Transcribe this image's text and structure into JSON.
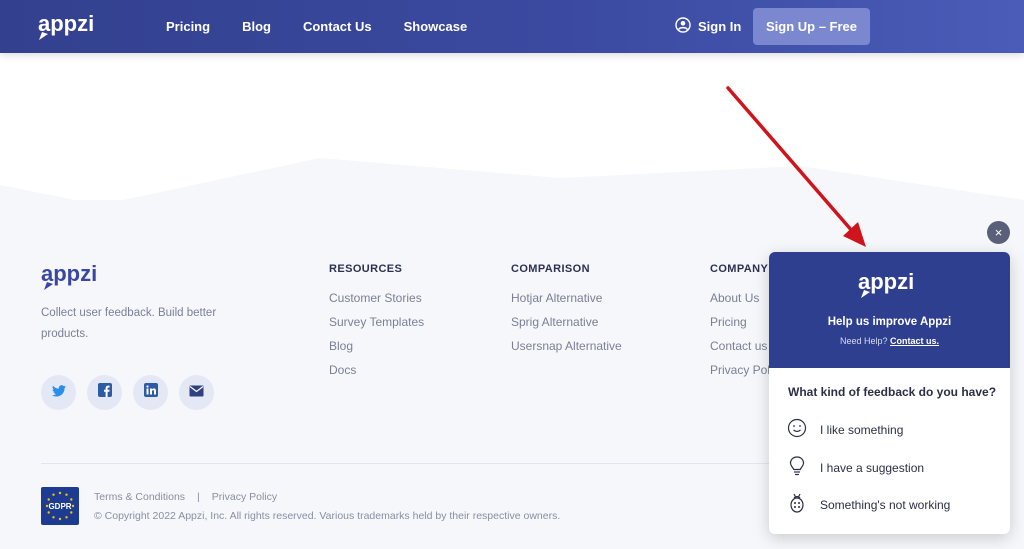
{
  "header": {
    "logo_text": "appzi",
    "nav": [
      "Pricing",
      "Blog",
      "Contact Us",
      "Showcase"
    ],
    "sign_in": "Sign In",
    "sign_up": "Sign Up – Free"
  },
  "footer": {
    "logo_text": "appzi",
    "tagline": "Collect user feedback. Build better products.",
    "socials": [
      "twitter-icon",
      "facebook-icon",
      "linkedin-icon",
      "mail-icon"
    ],
    "columns": [
      {
        "title": "RESOURCES",
        "links": [
          "Customer Stories",
          "Survey Templates",
          "Blog",
          "Docs"
        ]
      },
      {
        "title": "COMPARISON",
        "links": [
          "Hotjar Alternative",
          "Sprig Alternative",
          "Usersnap Alternative"
        ]
      },
      {
        "title": "COMPANY",
        "links": [
          "About Us",
          "Pricing",
          "Contact us",
          "Privacy Poli"
        ]
      }
    ],
    "gdpr_badge": "GDPR",
    "terms": "Terms & Conditions",
    "separator": "|",
    "privacy": "Privacy Policy",
    "copyright": "© Copyright 2022 Appzi, Inc.  All rights reserved.  Various trademarks held by their respective owners."
  },
  "widget": {
    "close_label": "×",
    "logo_text": "appzi",
    "title": "Help us improve Appzi",
    "help_prefix": "Need Help?",
    "help_link": "Contact us.",
    "question": "What kind of feedback do you have?",
    "options": [
      {
        "icon": "smiley-icon",
        "label": "I like something"
      },
      {
        "icon": "lightbulb-icon",
        "label": "I have a suggestion"
      },
      {
        "icon": "bug-icon",
        "label": "Something's not working"
      }
    ]
  },
  "colors": {
    "header": "#3b4aa0",
    "widget_header": "#2f3f8f",
    "signup_button": "#7b88d0",
    "arrow": "#d0141c",
    "footer_bg": "#f5f7fb"
  }
}
